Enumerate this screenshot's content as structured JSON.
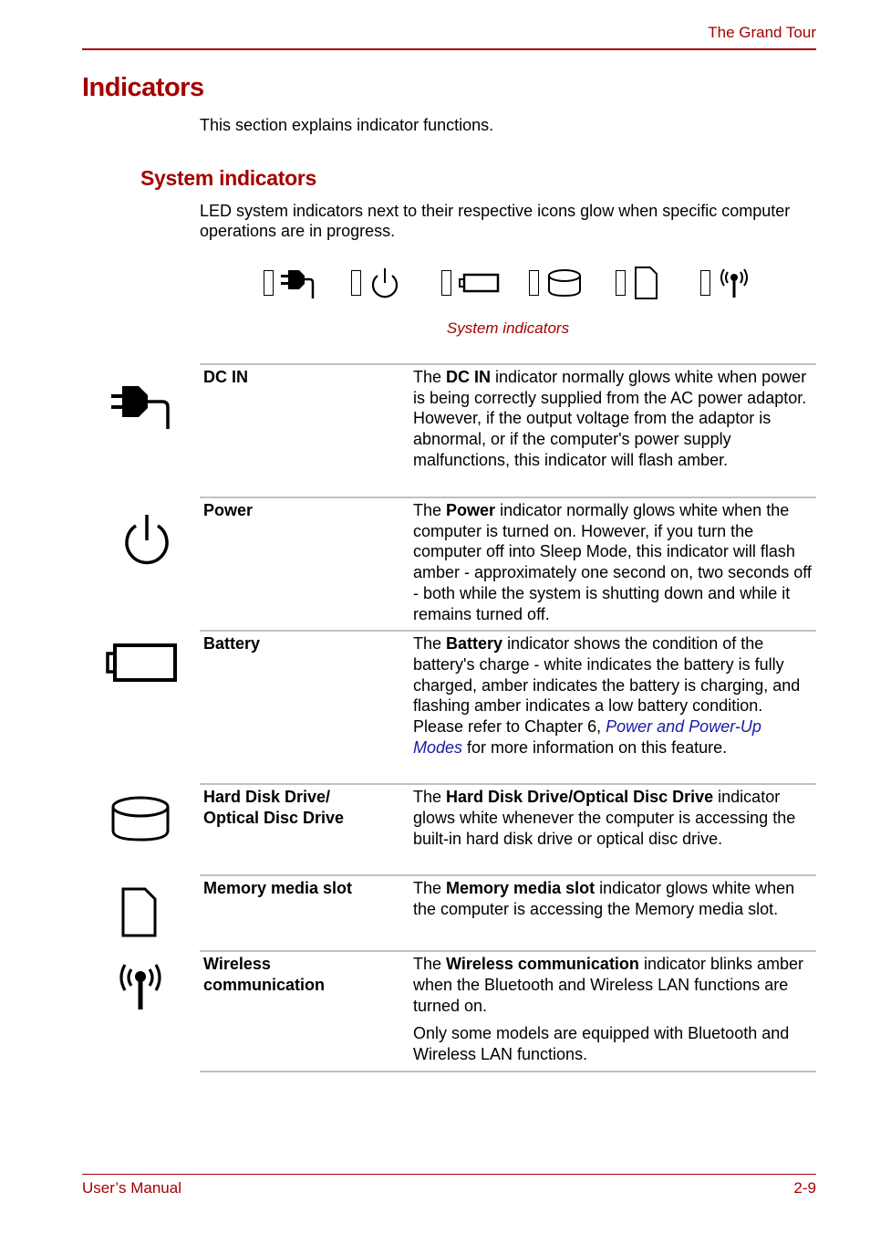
{
  "header": {
    "chapter_title": "The Grand Tour"
  },
  "page": {
    "title": "Indicators",
    "intro": "This section explains indicator functions.",
    "section_title": "System indicators",
    "section_lead": "LED system indicators next to their respective icons glow when specific computer operations are in progress.",
    "figure_caption": "System indicators",
    "strip_icons": [
      "dc-in-plug-icon",
      "power-icon",
      "battery-icon",
      "disk-drive-icon",
      "memory-card-icon",
      "wireless-antenna-icon"
    ]
  },
  "indicators": [
    {
      "name": "DC IN",
      "icon": "dc-in-plug-icon",
      "desc_pre": "The ",
      "desc_bold": "DC IN",
      "desc_post": " indicator normally glows white when power is being correctly supplied from the AC power adaptor. However, if the output voltage from the adaptor is abnormal, or if the computer's power supply malfunctions, this indicator will flash amber."
    },
    {
      "name": "Power",
      "icon": "power-icon",
      "desc_pre": "The ",
      "desc_bold": "Power",
      "desc_post": " indicator normally glows white when the computer is turned on. However, if you turn the computer off into Sleep Mode, this indicator will flash amber - approximately one second on, two seconds off - both while the system is shutting down and while it remains turned off."
    },
    {
      "name": "Battery",
      "icon": "battery-icon",
      "desc_pre": "The ",
      "desc_bold": "Battery",
      "desc_post": " indicator shows the condition of the battery's charge - white indicates the battery is fully charged, amber indicates the battery is charging, and flashing amber indicates a low battery condition. Please refer to Chapter 6, ",
      "desc_link": "Power and Power-Up Modes",
      "desc_tail": " for more information on this feature."
    },
    {
      "name_line1": "Hard Disk Drive/",
      "name_line2": "Optical Disc Drive",
      "icon": "disk-drive-icon",
      "desc_pre": "The ",
      "desc_bold": "Hard Disk Drive/Optical Disc Drive",
      "desc_post": " indicator glows white whenever the computer is accessing the built-in hard disk drive or optical disc drive."
    },
    {
      "name": "Memory media slot",
      "icon": "memory-card-icon",
      "desc_pre": "The ",
      "desc_bold": "Memory media slot",
      "desc_post": " indicator glows white when the computer is accessing the Memory media slot."
    },
    {
      "name_line1": "Wireless",
      "name_line2": "communication",
      "icon": "wireless-antenna-icon",
      "desc_pre": "The ",
      "desc_bold": "Wireless communication",
      "desc_post": " indicator blinks amber when the Bluetooth and Wireless LAN functions are turned on.",
      "note": "Only some models are equipped with Bluetooth and Wireless LAN functions."
    }
  ],
  "footer": {
    "manual_name": "User’s Manual",
    "page_number": "2-9"
  },
  "colors": {
    "accent": "#a50000",
    "link": "#1a1aa6",
    "rule": "#c0c0c0"
  }
}
